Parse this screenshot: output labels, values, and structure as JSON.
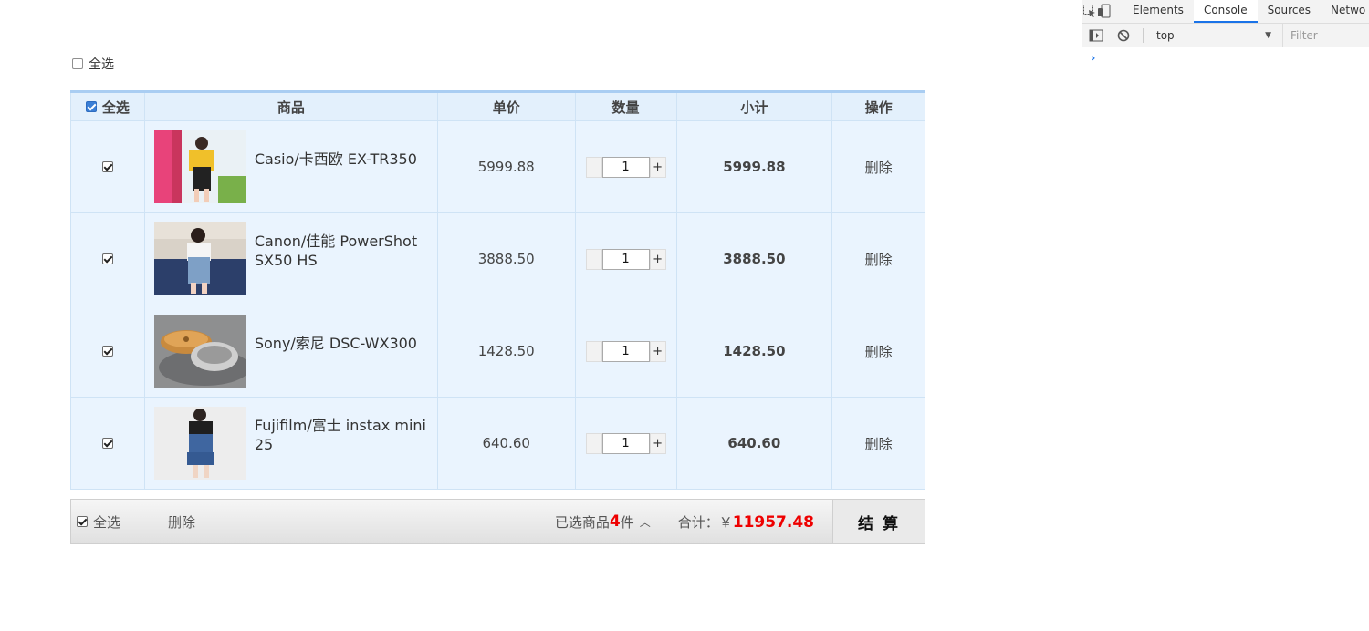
{
  "top_select": {
    "label": "全选",
    "checked": false
  },
  "table": {
    "headers": {
      "select_all": "全选",
      "goods": "商品",
      "price": "单价",
      "qty": "数量",
      "subtotal": "小计",
      "op": "操作"
    },
    "rows": [
      {
        "checked": true,
        "name": "Casio/卡西欧 EX-TR350",
        "price": "5999.88",
        "qty": "1",
        "subtotal": "5999.88",
        "op": "删除",
        "minus": "",
        "plus": "+"
      },
      {
        "checked": true,
        "name": "Canon/佳能 PowerShot SX50 HS",
        "price": "3888.50",
        "qty": "1",
        "subtotal": "3888.50",
        "op": "删除",
        "minus": "",
        "plus": "+"
      },
      {
        "checked": true,
        "name": "Sony/索尼 DSC-WX300",
        "price": "1428.50",
        "qty": "1",
        "subtotal": "1428.50",
        "op": "删除",
        "minus": "",
        "plus": "+"
      },
      {
        "checked": true,
        "name": "Fujifilm/富士 instax mini 25",
        "price": "640.60",
        "qty": "1",
        "subtotal": "640.60",
        "op": "删除",
        "minus": "",
        "plus": "+"
      }
    ]
  },
  "footer": {
    "select_all": "全选",
    "delete": "删除",
    "selected_prefix": "已选商品",
    "selected_count": "4",
    "selected_suffix": "件",
    "chevron": "︿",
    "total_label": "合计：￥",
    "total_amount": "11957.48",
    "checkout": "结 算"
  },
  "devtools": {
    "tabs": [
      "Elements",
      "Console",
      "Sources",
      "Netwo"
    ],
    "active_tab": "Console",
    "context": "top",
    "filter_placeholder": "Filter",
    "prompt": "›"
  },
  "colors": {
    "accent_red": "#e00000",
    "table_bg": "#eaf4fe",
    "table_border": "#cfe3f5",
    "devtools_active": "#1a73e8"
  }
}
